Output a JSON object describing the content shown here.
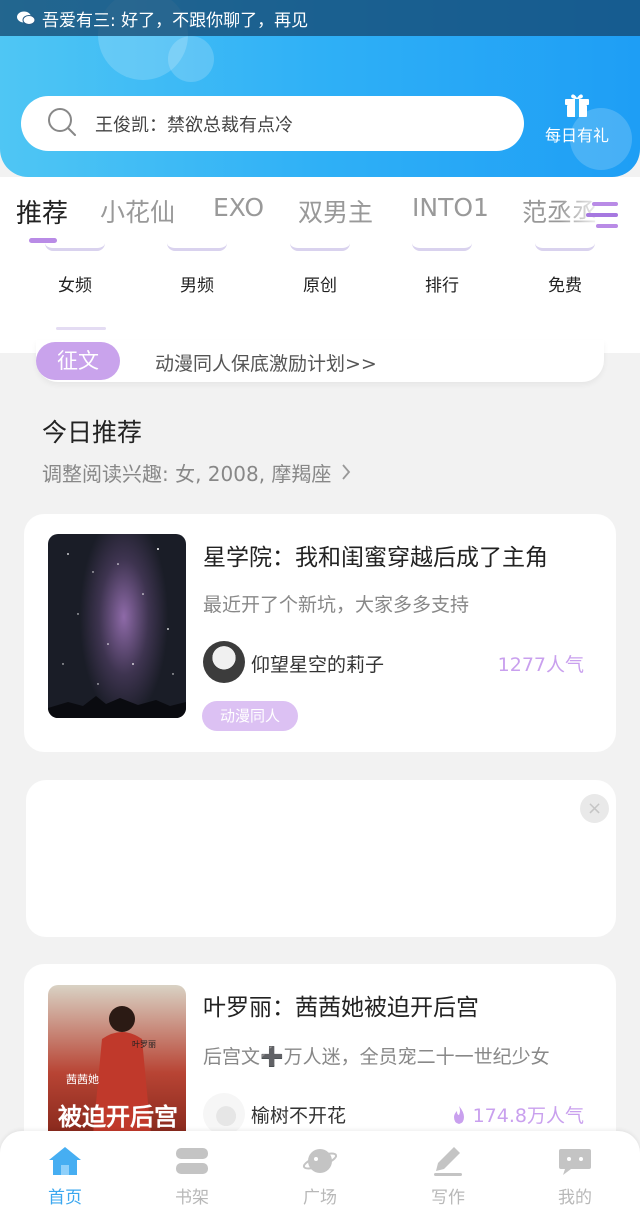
{
  "notification": {
    "icon": "wechat-icon",
    "text": "吾爱有三: 好了，不跟你聊了，再见"
  },
  "search": {
    "placeholder_text": "王俊凯：禁欲总裁有点冷",
    "icon": "search-icon"
  },
  "gift": {
    "label": "每日有礼",
    "icon": "gift-icon"
  },
  "tabs": [
    {
      "label": "推荐",
      "active": true
    },
    {
      "label": "小花仙"
    },
    {
      "label": "EXO"
    },
    {
      "label": "双男主"
    },
    {
      "label": "INTO1"
    },
    {
      "label": "范丞丞"
    }
  ],
  "categories": [
    {
      "label": "女频"
    },
    {
      "label": "男频"
    },
    {
      "label": "原创"
    },
    {
      "label": "排行"
    },
    {
      "label": "免费"
    }
  ],
  "banner": {
    "badge": "征文",
    "text": "动漫同人保底激励计划>>"
  },
  "today": {
    "title": "今日推荐",
    "subtitle": "调整阅读兴趣: 女, 2008, 摩羯座"
  },
  "books": [
    {
      "title": "星学院：我和闺蜜穿越后成了主角",
      "desc": "最近开了个新坑，大家多多支持",
      "author": "仰望星空的莉子",
      "popularity": "1277人气",
      "tag": "动漫同人"
    },
    {
      "title": "叶罗丽：茜茜她被迫开后宫",
      "desc": "后宫文➕万人迷，全员宠二十一世纪少女",
      "author": "榆树不开花",
      "popularity": "174.8万人气",
      "cover_text_top": "叶罗丽",
      "cover_text_mid": "茜茜她",
      "cover_text_big": "被迫开后宫"
    }
  ],
  "ad": {
    "close": "×"
  },
  "nav": [
    {
      "label": "首页",
      "icon": "home-icon",
      "active": true
    },
    {
      "label": "书架",
      "icon": "bookshelf-icon"
    },
    {
      "label": "广场",
      "icon": "planet-icon"
    },
    {
      "label": "写作",
      "icon": "pen-icon"
    },
    {
      "label": "我的",
      "icon": "chat-bubble-icon"
    }
  ],
  "colors": {
    "accent": "#3aa7ef",
    "purple": "#b98be6",
    "header_start": "#4fc6f4",
    "header_end": "#1e9ef5"
  }
}
